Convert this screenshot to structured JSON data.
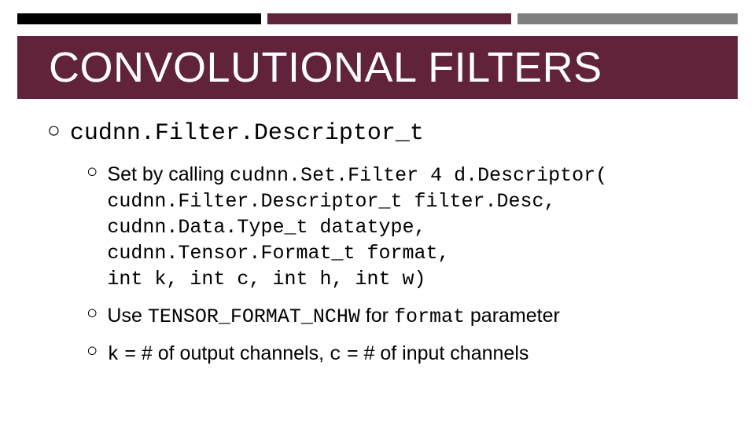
{
  "title": "CONVOLUTIONAL FILTERS",
  "colors": {
    "accent": "#61223b",
    "dark": "#000000",
    "grey": "#7f7f7f"
  },
  "main_bullet": "cudnn.Filter.Descriptor_t",
  "sub1_lead": "Set by calling ",
  "sub1_code1": "cudnn.Set.Filter 4 d.Descriptor(",
  "sub1_code_block": "cudnn.Filter.Descriptor_t filter.Desc,\ncudnn.Data.Type_t datatype,\ncudnn.Tensor.Format_t format,\nint k, int c, int h, int w)",
  "sub2_pre": "Use ",
  "sub2_code": "TENSOR_FORMAT_NCHW",
  "sub2_mid": " for ",
  "sub2_param": "format",
  "sub2_post": " parameter",
  "sub3_k": "k",
  "sub3_k_text": " = # of output channels, ",
  "sub3_c": "c",
  "sub3_c_text": " = # of input channels"
}
